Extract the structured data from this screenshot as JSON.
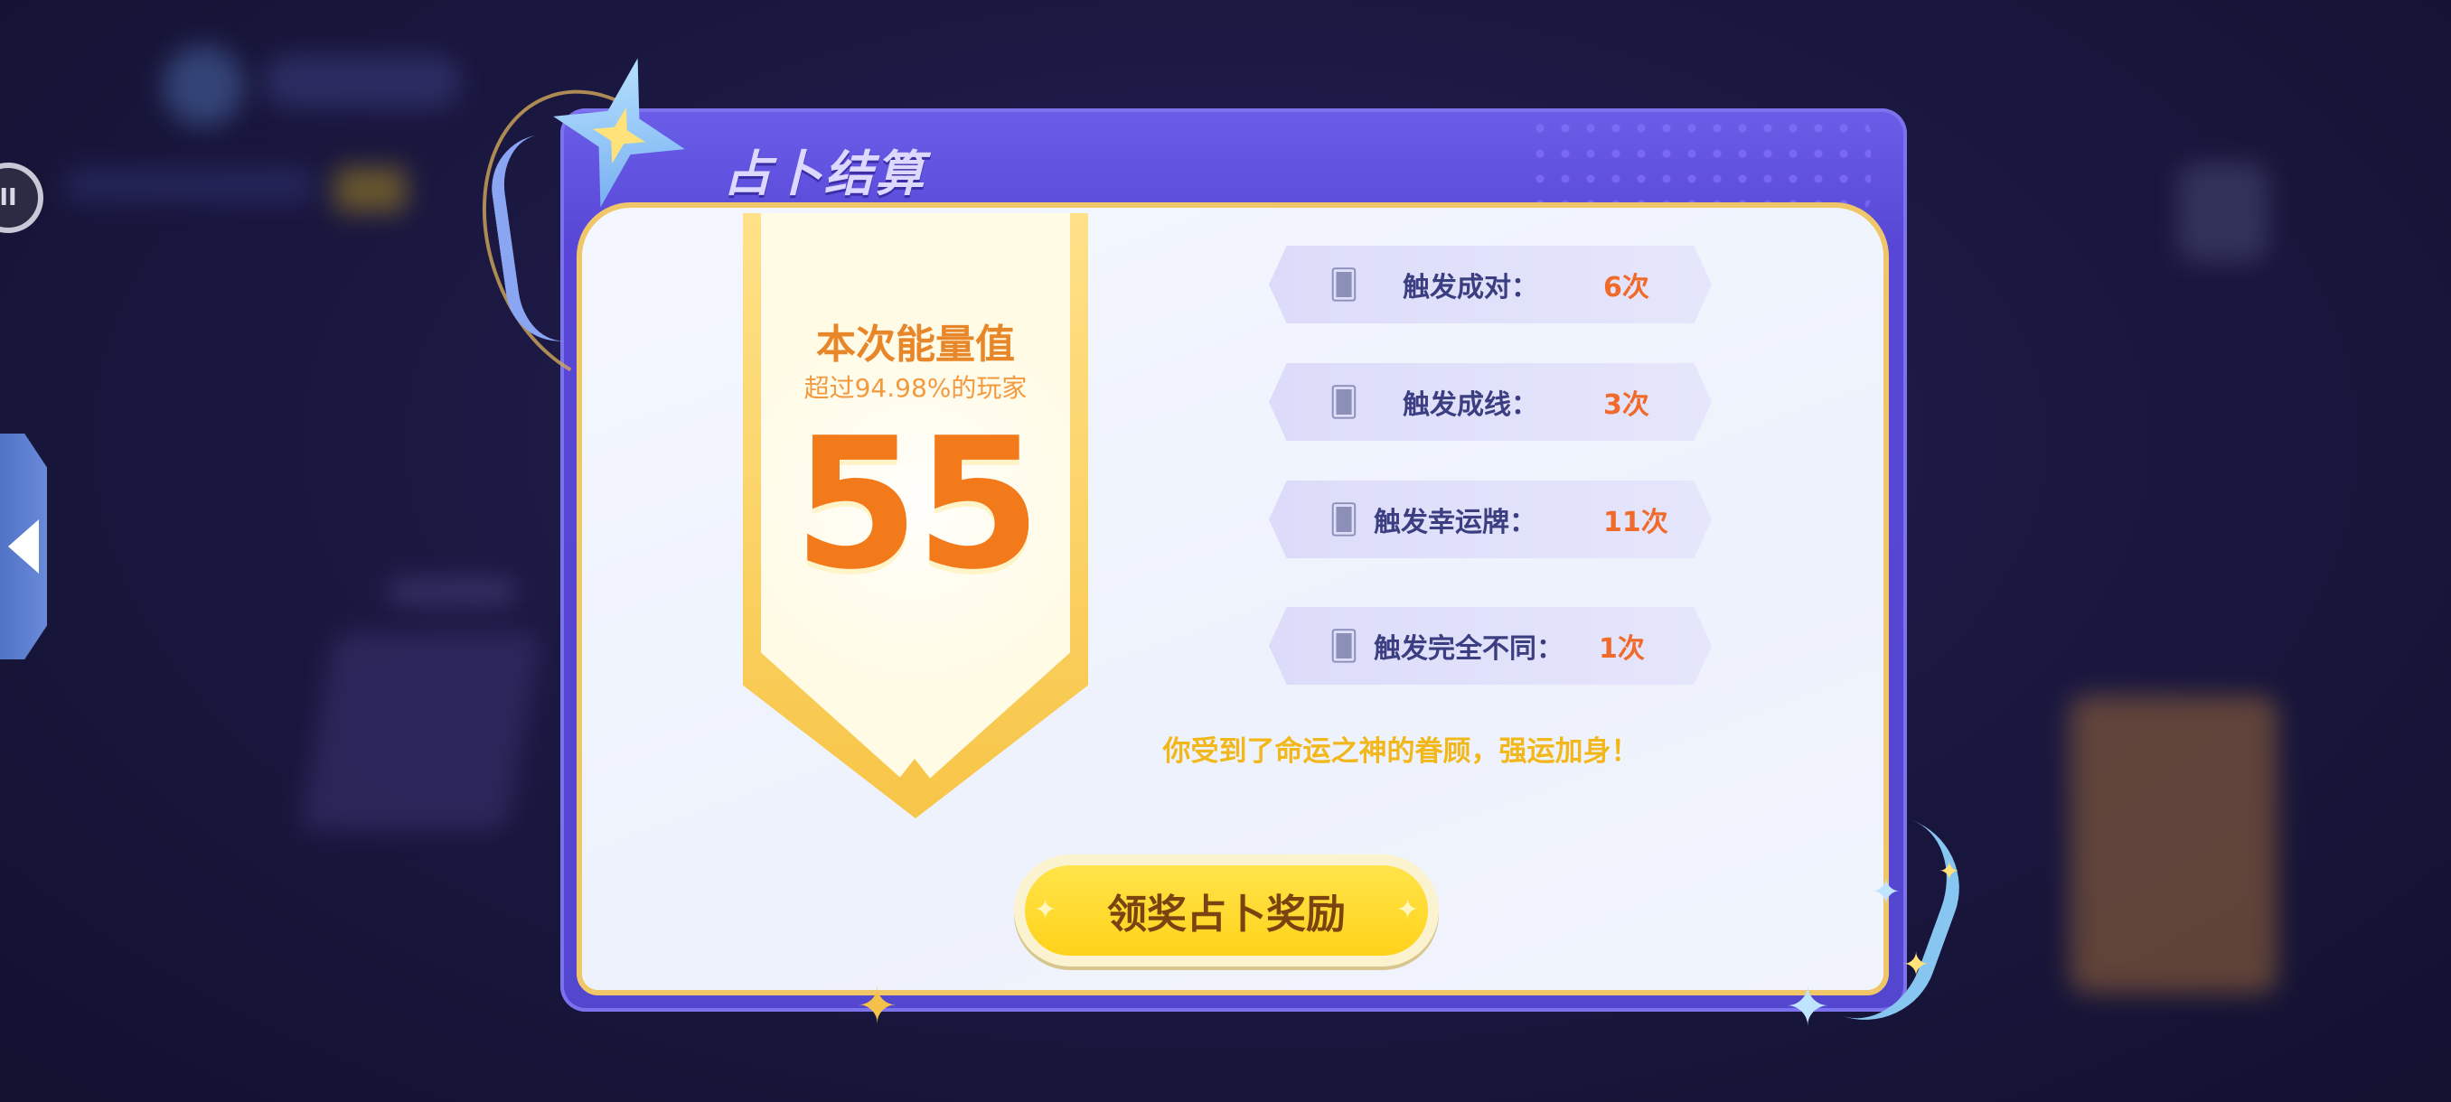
{
  "dialog": {
    "title": "占卜结算"
  },
  "energy": {
    "title": "本次能量值",
    "subtitle": "超过94.98%的玩家",
    "score": "55"
  },
  "stats": [
    {
      "label": "触发成对：",
      "value": "6次",
      "icon": "paired-cards-icon"
    },
    {
      "label": "触发成线：",
      "value": "3次",
      "icon": "stacked-cards-icon"
    },
    {
      "label": "触发幸运牌：",
      "value": "11次",
      "icon": "lucky-card-icon"
    },
    {
      "label": "触发完全不同：",
      "value": "1次",
      "icon": "distinct-cards-icon"
    }
  ],
  "blessing": "你受到了命运之神的眷顾，强运加身！",
  "claim_button": "领奖占卜奖励",
  "colors": {
    "dialog_frame": "#5847d6",
    "panel_border": "#f0c768",
    "score_orange": "#f27a1a",
    "stat_value": "#f06a2b",
    "blessing_text": "#f2b71a",
    "button_fill": "#ffd21a"
  }
}
